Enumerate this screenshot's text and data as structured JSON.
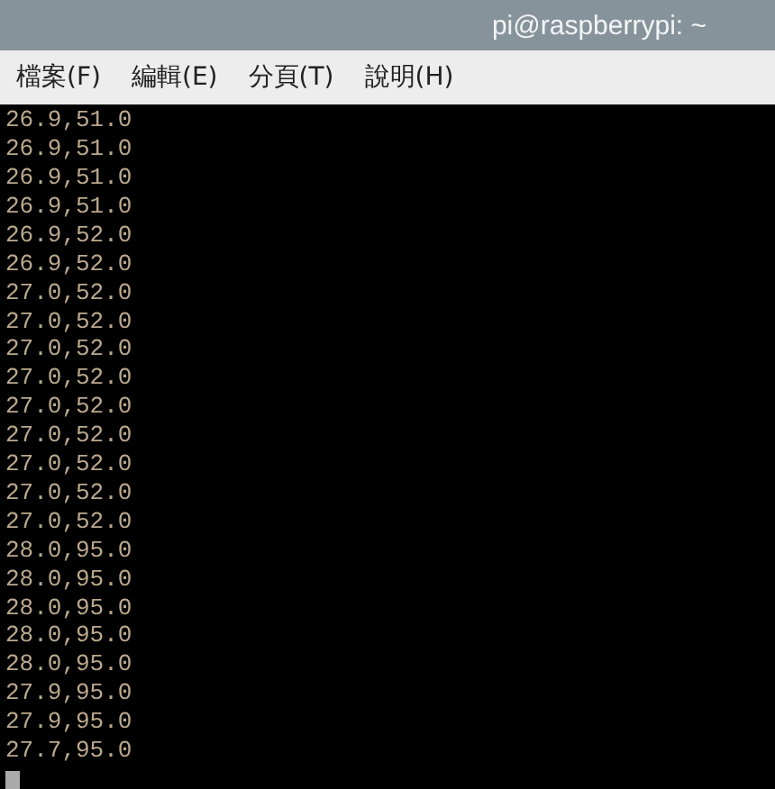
{
  "window": {
    "title": "pi@raspberrypi: ~"
  },
  "menu": [
    "檔案(F)",
    "編輯(E)",
    "分頁(T)",
    "說明(H)"
  ],
  "terminal": {
    "lines": [
      "26.9,51.0",
      "26.9,51.0",
      "26.9,51.0",
      "26.9,51.0",
      "26.9,52.0",
      "26.9,52.0",
      "27.0,52.0",
      "27.0,52.0",
      "27.0,52.0",
      "27.0,52.0",
      "27.0,52.0",
      "27.0,52.0",
      "27.0,52.0",
      "27.0,52.0",
      "27.0,52.0",
      "28.0,95.0",
      "28.0,95.0",
      "28.0,95.0",
      "28.0,95.0",
      "28.0,95.0",
      "27.9,95.0",
      "27.9,95.0",
      "27.7,95.0"
    ]
  }
}
